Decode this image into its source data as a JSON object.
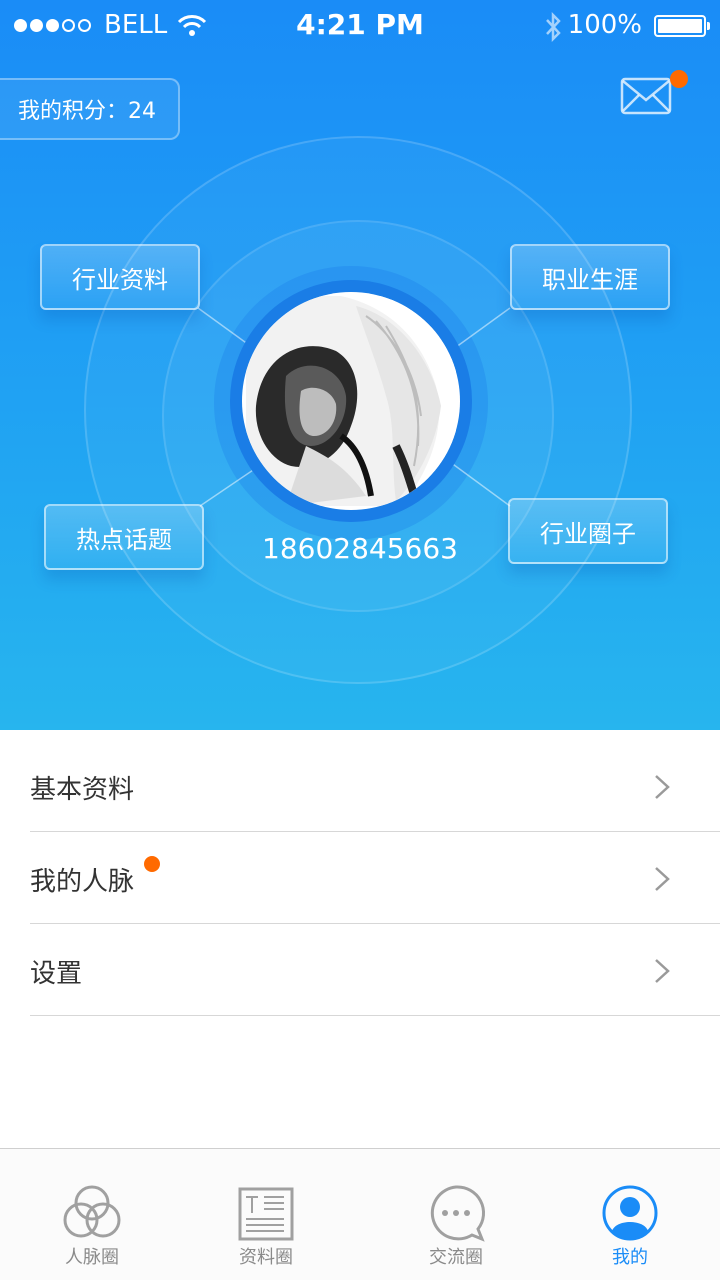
{
  "status_bar": {
    "carrier": "BELL",
    "time": "4:21 PM",
    "battery": "100%"
  },
  "points": {
    "label": "我的积分：24"
  },
  "user": {
    "phone": "18602845663"
  },
  "categories": [
    "行业资料",
    "职业生涯",
    "热点话题",
    "行业圈子"
  ],
  "menu": {
    "items": [
      {
        "label": "基本资料",
        "badge": false
      },
      {
        "label": "我的人脉",
        "badge": true
      },
      {
        "label": "设置",
        "badge": false
      }
    ]
  },
  "tabbar": {
    "tabs": [
      {
        "label": "人脉圈",
        "icon": "circles-icon"
      },
      {
        "label": "资料圈",
        "icon": "document-icon"
      },
      {
        "label": "交流圈",
        "icon": "chat-icon"
      },
      {
        "label": "我的",
        "icon": "profile-icon",
        "active": true
      }
    ]
  },
  "colors": {
    "primary": "#1a8cf7",
    "badge": "#ff6a00",
    "text": "#333333",
    "tab_inactive": "#8a8a8a"
  }
}
